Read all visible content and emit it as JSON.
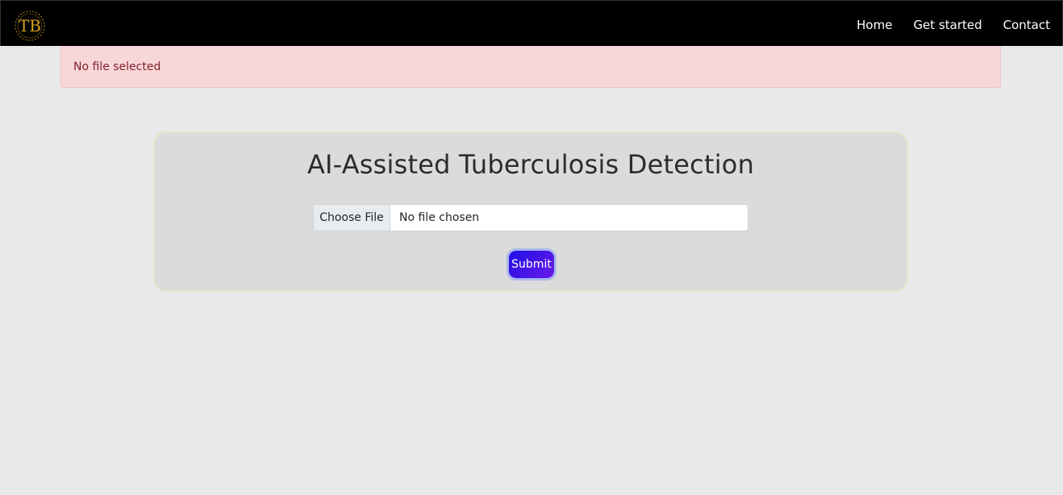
{
  "navbar": {
    "logo_text": "TB",
    "links": [
      "Home",
      "Get started",
      "Contact"
    ]
  },
  "alert": {
    "message": "No file selected"
  },
  "form": {
    "title": "AI-Assisted Tuberculosis Detection",
    "file_button_label": "Choose File",
    "file_status": "No file chosen",
    "submit_label": "Submit"
  },
  "colors": {
    "navbar_bg": "#000000",
    "logo_gold": "#d4a21e",
    "alert_bg": "#f8d7da",
    "alert_text": "#842029",
    "card_bg": "#dbdbdb",
    "submit_gradient_start": "#1f0fe6",
    "submit_gradient_end": "#6a1ae8"
  }
}
